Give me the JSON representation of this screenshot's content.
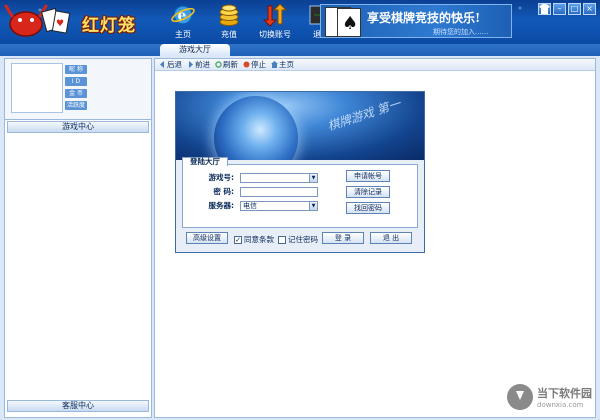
{
  "app": {
    "logo_text": "红灯笼",
    "nav": [
      {
        "label": "主页",
        "icon": "ie-globe-icon"
      },
      {
        "label": "充值",
        "icon": "coins-icon"
      },
      {
        "label": "切换账号",
        "icon": "switch-arrows-icon"
      },
      {
        "label": "退出",
        "icon": "exit-arrow-icon"
      }
    ],
    "banner": {
      "title": "享受棋牌竞技的快乐!",
      "subtitle": "期待您的加入......"
    },
    "window_controls": [
      "shirt-icon",
      "minimize-icon",
      "maximize-icon",
      "close-icon"
    ]
  },
  "tabs": [
    {
      "label": "游戏大厅",
      "active": true
    }
  ],
  "left": {
    "info_tags": [
      "昵 称",
      "I D",
      "金 币",
      "活跃度"
    ],
    "game_center": "游戏中心",
    "service_center": "客服中心"
  },
  "browser_toolbar": [
    {
      "label": "后退",
      "icon": "back-icon"
    },
    {
      "label": "前进",
      "icon": "forward-icon"
    },
    {
      "label": "刷新",
      "icon": "refresh-icon"
    },
    {
      "label": "停止",
      "icon": "stop-icon"
    },
    {
      "label": "主页",
      "icon": "home-icon"
    }
  ],
  "login": {
    "slogan": "棋牌游戏 第一",
    "tab": "登陆大厅",
    "fields": {
      "account": {
        "label": "游戏号:",
        "value": ""
      },
      "password": {
        "label": "密  码:",
        "value": ""
      },
      "server": {
        "label": "服务器:",
        "value": "电信"
      }
    },
    "side_buttons": {
      "register": "申请帐号",
      "clear": "清除记录",
      "recover": "找回密码"
    },
    "advanced": "高级设置",
    "agree": {
      "label": "同意条款",
      "checked": true
    },
    "remember": {
      "label": "记住密码",
      "checked": false
    },
    "submit": "登 录",
    "quit": "退 出"
  },
  "watermark": {
    "title": "当下软件园",
    "url": "downxia.com"
  },
  "colors": {
    "header_blue": "#1359b8",
    "frame_blue": "#d9e7f7",
    "border": "#9ab8de"
  }
}
